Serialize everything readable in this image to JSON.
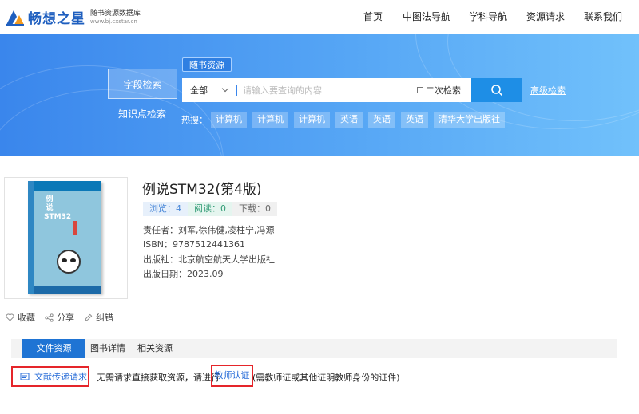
{
  "logo": {
    "name": "畅想之星",
    "sub1": "随书资源数据库",
    "sub2": "www.bj.cxstar.cn"
  },
  "nav": [
    "首页",
    "中图法导航",
    "学科导航",
    "资源请求",
    "联系我们"
  ],
  "search": {
    "side_tabs": [
      "字段检索",
      "知识点检索"
    ],
    "badge": "随书资源",
    "select_value": "全部",
    "placeholder": "请输入要查询的内容",
    "second_search": "二次检索",
    "advanced": "高级检索",
    "hot_label": "热搜：",
    "hot_tags": [
      "计算机",
      "计算机",
      "计算机",
      "英语",
      "英语",
      "英语",
      "清华大学出版社"
    ]
  },
  "book": {
    "cover_title": "例说STM32",
    "title": "例说STM32(第4版)",
    "stats": {
      "browse": "浏览：4",
      "read": "阅读：0",
      "download": "下载：0"
    },
    "author": "责任者：刘军,徐伟健,凌柱宁,冯源",
    "isbn": "ISBN：9787512441361",
    "publisher": "出版社：北京航空航天大学出版社",
    "date": "出版日期：2023.09"
  },
  "actions": {
    "favorite": "收藏",
    "share": "分享",
    "report": "纠错"
  },
  "tabs": [
    "文件资源",
    "图书详情",
    "相关资源"
  ],
  "resource": {
    "request_button": "文献传递请求",
    "notice_before": "无需请求直接获取资源，请进行",
    "teacher_link": "教师认证",
    "notice_after": "(需教师证或其他证明教师身份的证件)"
  },
  "colors": {
    "accent": "#1f74d4",
    "banner_start": "#3a86ec",
    "banner_end": "#71c1fb",
    "highlight": "#e5252a"
  }
}
